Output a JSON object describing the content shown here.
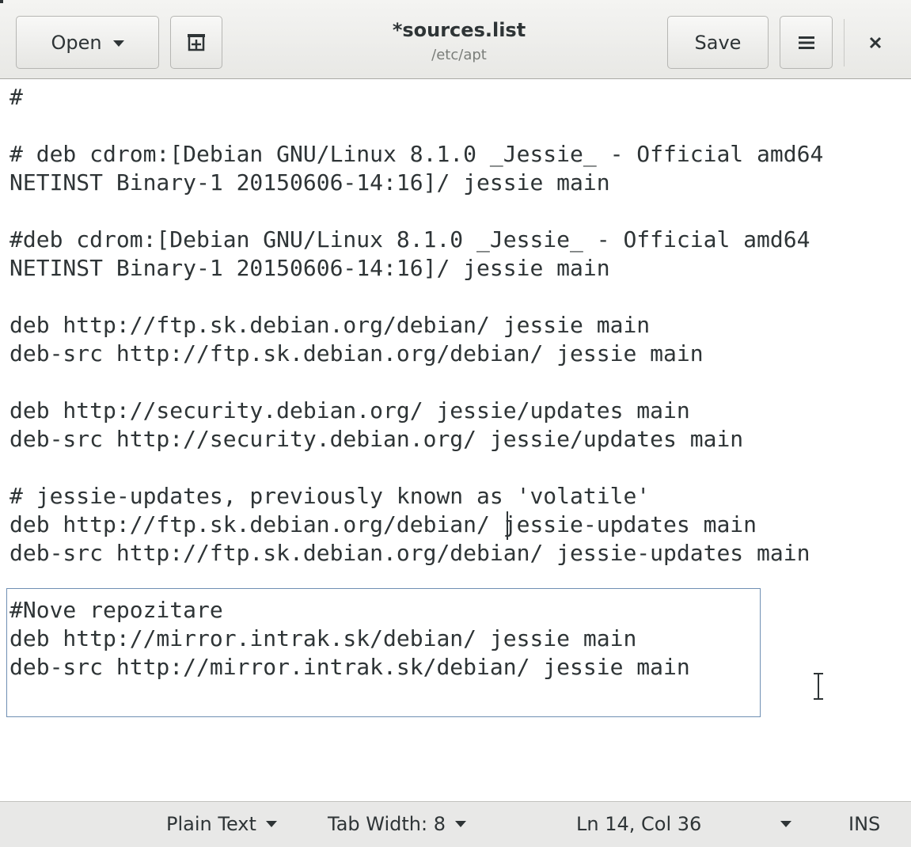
{
  "header": {
    "open_label": "Open",
    "save_label": "Save",
    "title": "*sources.list",
    "subtitle": "/etc/apt"
  },
  "editor": {
    "lines": [
      "#",
      "",
      "# deb cdrom:[Debian GNU/Linux 8.1.0 _Jessie_ - Official amd64",
      "NETINST Binary-1 20150606-14:16]/ jessie main",
      "",
      "#deb cdrom:[Debian GNU/Linux 8.1.0 _Jessie_ - Official amd64",
      "NETINST Binary-1 20150606-14:16]/ jessie main",
      "",
      "deb http://ftp.sk.debian.org/debian/ jessie main",
      "deb-src http://ftp.sk.debian.org/debian/ jessie main",
      "",
      "deb http://security.debian.org/ jessie/updates main",
      "deb-src http://security.debian.org/ jessie/updates main",
      "",
      "# jessie-updates, previously known as 'volatile'",
      "deb http://ftp.sk.debian.org/debian/ jessie-updates main",
      "deb-src http://ftp.sk.debian.org/debian/ jessie-updates main",
      "",
      "#Nove repozitare",
      "deb http://mirror.intrak.sk/debian/ jessie main",
      "deb-src http://mirror.intrak.sk/debian/ jessie main"
    ]
  },
  "statusbar": {
    "language": "Plain Text",
    "tab_width": "Tab Width: 8",
    "position": "Ln 14, Col 36",
    "mode": "INS"
  }
}
